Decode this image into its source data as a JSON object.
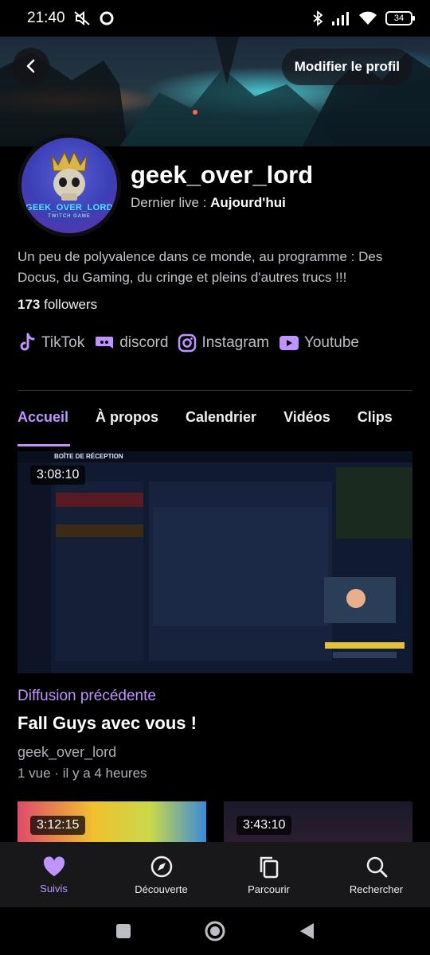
{
  "status_bar": {
    "time": "21:40",
    "battery": "34"
  },
  "header": {
    "back_label": "Retour",
    "edit_profile": "Modifier le profil"
  },
  "profile": {
    "avatar_brand": "GEEK_OVER_LORD",
    "avatar_sub": "TWITCH GAME",
    "username": "geek_over_lord",
    "last_live_label": "Dernier live : ",
    "last_live_value": "Aujourd'hui",
    "bio": "Un peu de polyvalence dans ce monde, au programme : Des Docus, du Gaming, du cringe et pleins d'autres trucs !!!",
    "followers_count": "173",
    "followers_label": " followers"
  },
  "socials": [
    {
      "label": "TikTok",
      "icon": "tiktok-icon"
    },
    {
      "label": "discord",
      "icon": "discord-icon"
    },
    {
      "label": "Instagram",
      "icon": "instagram-icon"
    },
    {
      "label": "Youtube",
      "icon": "youtube-icon"
    }
  ],
  "tabs": [
    "Accueil",
    "À propos",
    "Calendrier",
    "Vidéos",
    "Clips"
  ],
  "main_video": {
    "duration": "3:08:10",
    "section_label": "Diffusion précédente",
    "title": "Fall Guys avec vous !",
    "channel": "geek_over_lord",
    "meta": "1 vue · il y a 4 heures",
    "inbox_title": "BOÎTE DE RÉCEPTION"
  },
  "more_videos": [
    {
      "duration": "3:12:15"
    },
    {
      "duration": "3:43:10"
    }
  ],
  "bottom_nav": [
    {
      "label": "Suivis",
      "icon": "heart-icon",
      "active": true
    },
    {
      "label": "Découverte",
      "icon": "compass-icon"
    },
    {
      "label": "Parcourir",
      "icon": "browse-icon"
    },
    {
      "label": "Rechercher",
      "icon": "search-icon"
    }
  ],
  "colors": {
    "accent": "#bf94ff",
    "background": "#000000",
    "nav_bg": "#18181b"
  }
}
